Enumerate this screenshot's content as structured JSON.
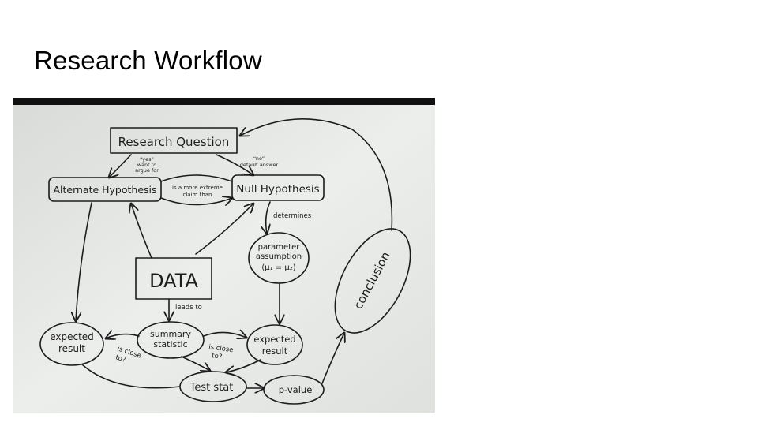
{
  "slide": {
    "title": "Research Workflow"
  },
  "diagram": {
    "nodes": {
      "research_question": "Research Question",
      "alternate_hypothesis": "Alternate Hypothesis",
      "null_hypothesis": "Null Hypothesis",
      "data": "DATA",
      "parameter_assumption_line1": "parameter",
      "parameter_assumption_line2": "assumption",
      "parameter_assumption_line3": "(μ₁ = μ₂)",
      "summary_statistic_line1": "summary",
      "summary_statistic_line2": "statistic",
      "expected_result_left_line1": "expected",
      "expected_result_left_line2": "result",
      "expected_result_right_line1": "expected",
      "expected_result_right_line2": "result",
      "test_stat": "Test stat",
      "p_value": "p-value",
      "conclusion": "conclusion"
    },
    "edge_labels": {
      "yes_line1": "“yes”",
      "yes_line2": "want to",
      "yes_line3": "argue for",
      "no_line1": "“no”",
      "no_line2": "default answer",
      "more_extreme_line1": "is a more extreme",
      "more_extreme_line2": "claim than",
      "determines": "determines",
      "leads_to": "leads to",
      "is_close_to_left_line1": "is close",
      "is_close_to_left_line2": "to?",
      "is_close_to_right_line1": "is close",
      "is_close_to_right_line2": "to?"
    }
  }
}
